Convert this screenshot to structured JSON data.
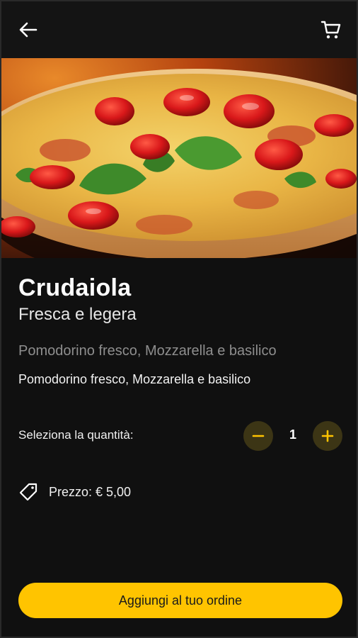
{
  "header": {
    "back_icon": "arrow-left-icon",
    "cart_icon": "shopping-cart-icon"
  },
  "product": {
    "name": "Crudaiola",
    "tagline": "Fresca e legera",
    "ingredients_muted": "Pomodorino fresco, Mozzarella e basilico",
    "ingredients": "Pomodorino fresco, Mozzarella e basilico",
    "image_subject": "pizza with cherry tomatoes, mozzarella and basil"
  },
  "quantity": {
    "label": "Seleziona la quantità:",
    "value": "1",
    "decrement_icon": "minus-icon",
    "increment_icon": "plus-icon"
  },
  "price": {
    "icon": "price-tag-icon",
    "text": "Prezzo: € 5,00"
  },
  "actions": {
    "add_label": "Aggiungi al tuo ordine"
  },
  "colors": {
    "background": "#101010",
    "accent": "#ffc400",
    "stepper_bg": "#3c3515",
    "muted_text": "#8e8e8e"
  }
}
